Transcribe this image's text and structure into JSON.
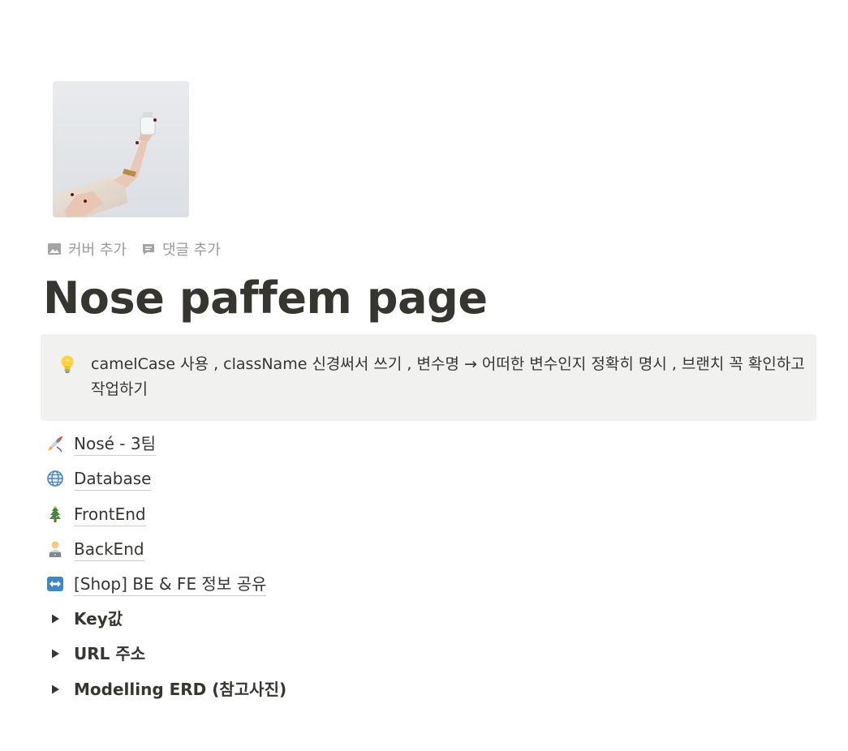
{
  "page": {
    "title": "Nose paffem page",
    "icon": "perfume-bottle-photo"
  },
  "controls": {
    "add_cover": {
      "label": "커버 추가",
      "icon": "image-icon"
    },
    "add_comment": {
      "label": "댓글 추가",
      "icon": "comment-icon"
    }
  },
  "callout": {
    "icon": "lightbulb-icon",
    "text": "camelCase 사용 ,  className 신경써서 쓰기 , 변수명 → 어떠한 변수인지 정확히 명시 , 브랜치 꼭 확인하고 작업하기",
    "background": "#f1f1ef"
  },
  "links": [
    {
      "label": "Nosé - 3팀",
      "icon": "rocket-icon"
    },
    {
      "label": "Database",
      "icon": "globe-icon"
    },
    {
      "label": "FrontEnd",
      "icon": "christmas-tree-icon"
    },
    {
      "label": "BackEnd",
      "icon": "technologist-icon"
    },
    {
      "label": "[Shop] BE & FE 정보 공유",
      "icon": "left-right-arrow-icon"
    }
  ],
  "toggles": [
    {
      "label": "Key값"
    },
    {
      "label": "URL 주소"
    },
    {
      "label": "Modelling ERD (참고사진)"
    }
  ],
  "colors": {
    "text": "#37352f",
    "muted": "#9b9a97"
  }
}
